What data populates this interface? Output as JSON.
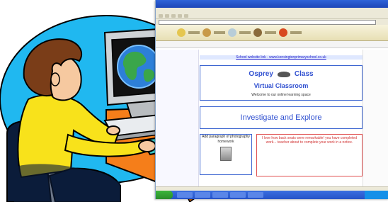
{
  "browser": {
    "school_link": "School website link - www.kensingtonprimaryschool.co.uk",
    "hero": {
      "title_left": "Osprey",
      "title_right": "Class",
      "subtitle": "Virtual Classroom",
      "tagline": "Welcome to our online learning space"
    },
    "explore": {
      "small_caption": "",
      "title": "Investigate and Explore"
    },
    "photo_box": {
      "text": "Add paragraph of photography",
      "sub": "homework"
    },
    "notice_box": {
      "text": "I love how back seats were remarkable! you have completed work... teacher about to complete your work in a notice."
    }
  },
  "colors": {
    "sky_circle": "#20b8f0",
    "desk": "#f57e1a",
    "shirt": "#f8e21b",
    "hair": "#7a3d18",
    "monitor": "#cfd3d6",
    "globe_ocean": "#2d7fd8",
    "globe_land": "#3aa64a",
    "heading_blue": "#3050d0",
    "notice_red": "#d03030"
  }
}
